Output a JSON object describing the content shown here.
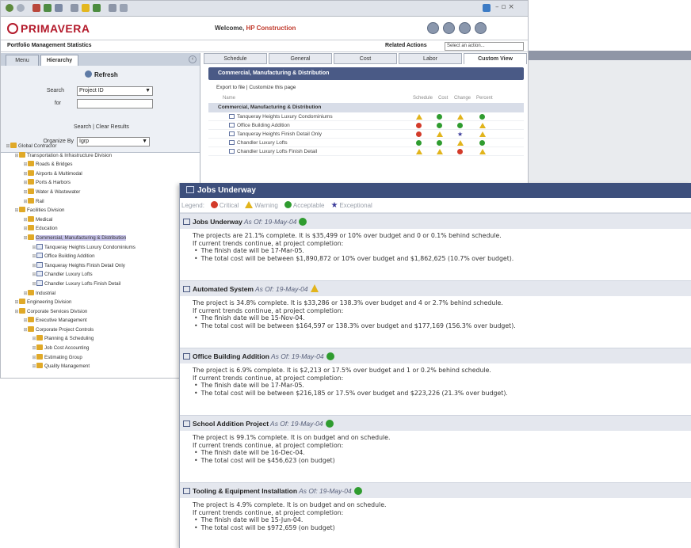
{
  "back": {
    "brand": "PRIMAVERA",
    "welcome_prefix": "Welcome,",
    "welcome_org": "HP Construction",
    "subtitle": "Portfolio Management Statistics",
    "related_actions_label": "Related Actions",
    "related_actions_value": "Select an action...",
    "left_tabs": [
      "Menu",
      "Hierarchy"
    ],
    "refresh": "Refresh",
    "search_label": "Search",
    "search_field": "Project ID",
    "for_label": "for",
    "search_links": "Search | Clear Results",
    "organize_label": "Organize By",
    "organize_value": "Igrp",
    "tree": [
      {
        "level": 0,
        "type": "folder",
        "label": "Global Contractor"
      },
      {
        "level": 1,
        "type": "folder",
        "label": "Transportation & Infrastructure Division"
      },
      {
        "level": 2,
        "type": "folder",
        "label": "Roads & Bridges"
      },
      {
        "level": 2,
        "type": "folder",
        "label": "Airports & Multimodal"
      },
      {
        "level": 2,
        "type": "folder",
        "label": "Ports & Harbors"
      },
      {
        "level": 2,
        "type": "folder",
        "label": "Water & Wastewater"
      },
      {
        "level": 2,
        "type": "folder",
        "label": "Rail"
      },
      {
        "level": 1,
        "type": "folder",
        "label": "Facilities Division"
      },
      {
        "level": 2,
        "type": "folder",
        "label": "Medical"
      },
      {
        "level": 2,
        "type": "folder",
        "label": "Education"
      },
      {
        "level": 2,
        "type": "folder",
        "label": "Commercial, Manufacturing & Distribution",
        "selected": true
      },
      {
        "level": 3,
        "type": "proj",
        "label": "Tanqueray Heights Luxury Condominiums"
      },
      {
        "level": 3,
        "type": "proj",
        "label": "Office Building Addition"
      },
      {
        "level": 3,
        "type": "proj",
        "label": "Tanqueray Heights Finish Detail Only"
      },
      {
        "level": 3,
        "type": "proj",
        "label": "Chandler Luxury Lofts"
      },
      {
        "level": 3,
        "type": "proj",
        "label": "Chandler Luxury Lofts Finish Detail"
      },
      {
        "level": 2,
        "type": "folder",
        "label": "Industrial"
      },
      {
        "level": 1,
        "type": "folder",
        "label": "Engineering Division"
      },
      {
        "level": 1,
        "type": "folder",
        "label": "Corporate Services Division"
      },
      {
        "level": 2,
        "type": "folder",
        "label": "Executive Management"
      },
      {
        "level": 2,
        "type": "folder",
        "label": "Corporate Project Controls"
      },
      {
        "level": 3,
        "type": "folder",
        "label": "Planning & Scheduling"
      },
      {
        "level": 3,
        "type": "folder",
        "label": "Job Cost Accounting"
      },
      {
        "level": 3,
        "type": "folder",
        "label": "Estimating Group"
      },
      {
        "level": 3,
        "type": "folder",
        "label": "Quality Management"
      }
    ],
    "right_tabs": [
      "Schedule",
      "General",
      "Cost",
      "Labor",
      "Custom View"
    ],
    "section_title": "Commercial, Manufacturing & Distribution",
    "export_links": "Export to file  |  Customize this page",
    "col_name": "Name",
    "col_heads": [
      "Schedule",
      "Cost",
      "Change",
      "Percent"
    ],
    "group_label": "Commercial, Manufacturing & Distribution",
    "projects": [
      {
        "name": "Tanqueray Heights Luxury Condominiums",
        "status": [
          "yellow",
          "green",
          "yellow",
          "green"
        ]
      },
      {
        "name": "Office Building Addition",
        "status": [
          "red",
          "green",
          "green",
          "yellow"
        ]
      },
      {
        "name": "Tanqueray Heights Finish Detail Only",
        "status": [
          "red",
          "yellow",
          "star",
          "yellow"
        ]
      },
      {
        "name": "Chandler Luxury Lofts",
        "status": [
          "green",
          "green",
          "yellow",
          "green"
        ]
      },
      {
        "name": "Chandler Luxury Lofts Finish Detail",
        "status": [
          "yellow",
          "yellow",
          "red",
          "yellow"
        ]
      }
    ]
  },
  "front": {
    "title": "Jobs Underway",
    "legend_label": "Legend:",
    "legend": [
      {
        "label": "Critical",
        "color": "#d33b2a",
        "shape": "dot"
      },
      {
        "label": "Warning",
        "color": "#e2b41b",
        "shape": "triangle"
      },
      {
        "label": "Acceptable",
        "color": "#2f9c2f",
        "shape": "dot"
      },
      {
        "label": "Exceptional",
        "color": "#3b3b9a",
        "shape": "star"
      }
    ],
    "jobs": [
      {
        "name": "Jobs Underway",
        "asof": "As Of: 19-May-04",
        "status": "green",
        "summary": "The projects are 21.1% complete. It is $35,499 or 10% over budget and 0 or 0.1% behind schedule.",
        "trend": "If current trends continue, at project completion:",
        "bullets": [
          "The finish date will be 17-Mar-05.",
          "The total cost will be between $1,890,872 or 10% over budget and $1,862,625 (10.7% over budget)."
        ]
      },
      {
        "name": "Automated System",
        "asof": "As Of: 19-May-04",
        "status": "yellow",
        "summary": "The project is 34.8% complete. It is $33,286 or 138.3% over budget and 4 or 2.7% behind schedule.",
        "trend": "If current trends continue, at project completion:",
        "bullets": [
          "The finish date will be 15-Nov-04.",
          "The total cost will be between $164,597 or 138.3% over budget and $177,169 (156.3% over budget)."
        ]
      },
      {
        "name": "Office Building Addition",
        "asof": "As Of: 19-May-04",
        "status": "green",
        "summary": "The project is 6.9% complete. It is $2,213 or 17.5% over budget and 1 or 0.2% behind schedule.",
        "trend": "If current trends continue, at project completion:",
        "bullets": [
          "The finish date will be 17-Mar-05.",
          "The total cost will be between $216,185 or 17.5% over budget and $223,226 (21.3% over budget)."
        ]
      },
      {
        "name": "School Addition Project",
        "asof": "As Of: 19-May-04",
        "status": "green",
        "summary": "The project is 99.1% complete. It is on budget and on schedule.",
        "trend": "If current trends continue, at project completion:",
        "bullets": [
          "The finish date will be 16-Dec-04.",
          "The total cost will be $456,623 (on budget)"
        ]
      },
      {
        "name": "Tooling & Equipment Installation",
        "asof": "As Of: 19-May-04",
        "status": "green",
        "summary": "The project is 4.9% complete. It is on budget and on schedule.",
        "trend": "If current trends continue, at project completion:",
        "bullets": [
          "The finish date will be 15-Jun-04.",
          "The total cost will be $972,659 (on budget)"
        ]
      }
    ]
  }
}
